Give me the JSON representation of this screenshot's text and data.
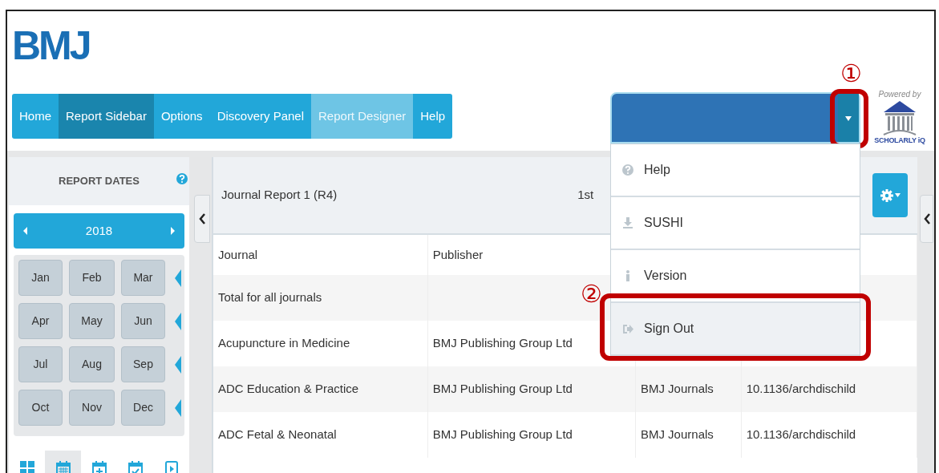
{
  "logo": {
    "text": "BMJ"
  },
  "nav": [
    {
      "label": "Home",
      "selected": false,
      "disabled": false
    },
    {
      "label": "Report Sidebar",
      "selected": true,
      "disabled": false
    },
    {
      "label": "Options",
      "selected": false,
      "disabled": false
    },
    {
      "label": "Discovery Panel",
      "selected": false,
      "disabled": false
    },
    {
      "label": "Report Designer",
      "selected": false,
      "disabled": true
    },
    {
      "label": "Help",
      "selected": false,
      "disabled": false
    }
  ],
  "user_menu": {
    "expanded": true,
    "annotation": "①",
    "items": [
      {
        "kind": "help",
        "label": "Help",
        "highlighted": false
      },
      {
        "kind": "download",
        "label": "SUSHI",
        "highlighted": false
      },
      {
        "kind": "info",
        "label": "Version",
        "highlighted": false
      },
      {
        "kind": "signout",
        "label": "Sign Out",
        "highlighted": true,
        "annotation": "②"
      }
    ]
  },
  "powered_by": {
    "caption": "Powered by",
    "brand": "SCHOLARLY iQ"
  },
  "sidebar": {
    "title": "REPORT DATES",
    "year": "2018",
    "quarters": [
      {
        "months": [
          "Jan",
          "Feb",
          "Mar"
        ]
      },
      {
        "months": [
          "Apr",
          "May",
          "Jun"
        ]
      },
      {
        "months": [
          "Jul",
          "Aug",
          "Sep"
        ]
      },
      {
        "months": [
          "Oct",
          "Nov",
          "Dec"
        ]
      }
    ],
    "view_tabs": [
      {
        "kind": "grid",
        "selected": false
      },
      {
        "kind": "calendar",
        "selected": true
      },
      {
        "kind": "calendar-plus",
        "selected": false
      },
      {
        "kind": "calendar-check",
        "selected": false
      },
      {
        "kind": "play",
        "selected": false
      }
    ]
  },
  "report": {
    "title": "Journal Report 1 (R4)",
    "title_fragment": "1st",
    "table": {
      "columns": [
        "Journal",
        "Publisher"
      ],
      "rows": [
        [
          "Total for all journals",
          null,
          null,
          null
        ],
        [
          "Acupuncture in Medicine",
          "BMJ Publishing Group Ltd",
          null,
          null
        ],
        [
          "ADC Education & Practice",
          "BMJ Publishing Group Ltd",
          "BMJ Journals",
          "10.1136/archdischild"
        ],
        [
          "ADC Fetal & Neonatal",
          "BMJ Publishing Group Ltd",
          "BMJ Journals",
          "10.1136/archdischild"
        ]
      ]
    }
  }
}
